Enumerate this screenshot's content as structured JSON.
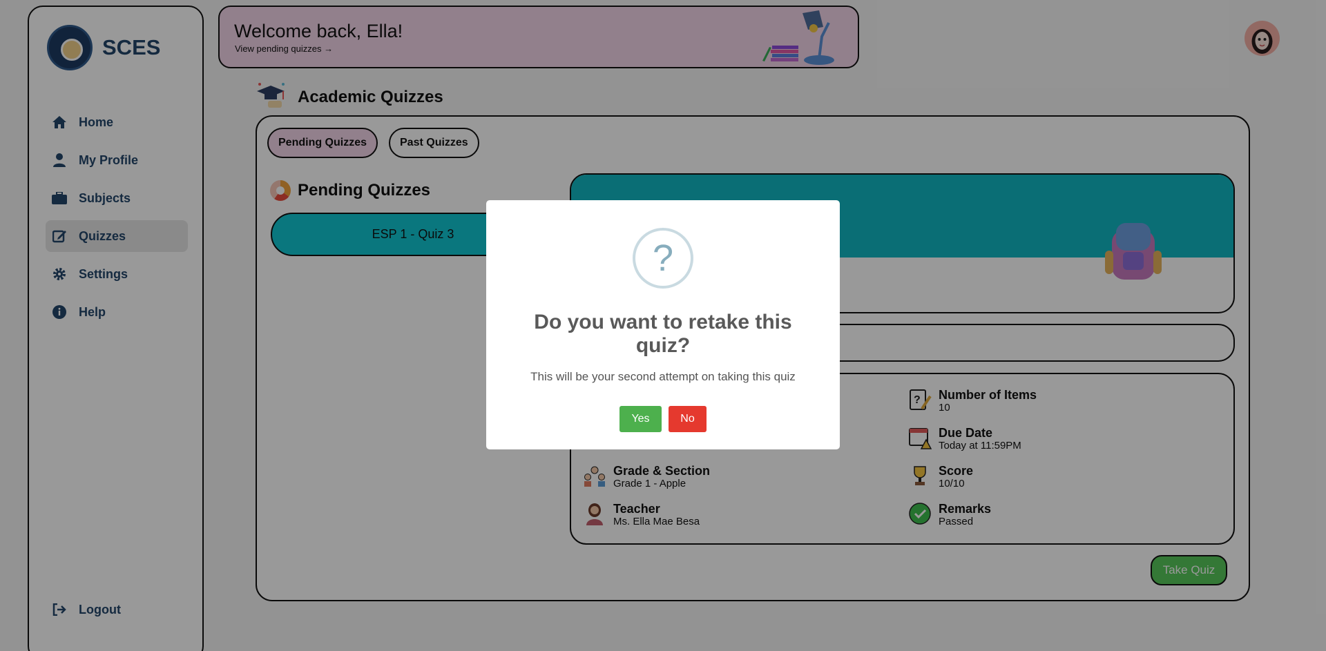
{
  "brand": {
    "name": "SCES"
  },
  "sidebar": {
    "items": [
      {
        "label": "Home",
        "icon": "home-icon"
      },
      {
        "label": "My Profile",
        "icon": "user-icon"
      },
      {
        "label": "Subjects",
        "icon": "briefcase-icon"
      },
      {
        "label": "Quizzes",
        "icon": "edit-icon",
        "active": true
      },
      {
        "label": "Settings",
        "icon": "gear-icon"
      },
      {
        "label": "Help",
        "icon": "info-icon"
      }
    ],
    "logout": "Logout"
  },
  "banner": {
    "welcome": "Welcome back, Ella!",
    "link": "View pending quizzes →"
  },
  "page": {
    "title": "Academic Quizzes"
  },
  "tabs": [
    {
      "label": "Pending Quizzes"
    },
    {
      "label": "Past Quizzes"
    }
  ],
  "list": {
    "title": "Pending Quizzes",
    "items": [
      {
        "label": "ESP 1 - Quiz 3"
      }
    ]
  },
  "details": {
    "mid_fragment": "-",
    "fields": [
      {
        "label": "Number of Items",
        "value": "10",
        "icon": "question-paper-icon"
      },
      {
        "label": "Due Date",
        "value": "Today at 11:59PM",
        "icon": "calendar-warning-icon"
      },
      {
        "label": "Grade & Section",
        "value": "Grade 1 - Apple",
        "icon": "students-icon"
      },
      {
        "label": "Score",
        "value": "10/10",
        "icon": "trophy-icon"
      },
      {
        "label": "Teacher",
        "value": "Ms. Ella Mae Besa",
        "icon": "teacher-icon"
      },
      {
        "label": "Remarks",
        "value": "Passed",
        "icon": "check-circle-icon"
      }
    ],
    "take_quiz": "Take Quiz"
  },
  "modal": {
    "icon": "?",
    "title": "Do you want to retake this quiz?",
    "text": "This will be your second attempt on taking this quiz",
    "yes": "Yes",
    "no": "No"
  },
  "colors": {
    "accent": "#12c7d3",
    "banner": "#f3d6ea",
    "brand_text": "#23466b",
    "yes": "#4db04d",
    "no": "#e5392e",
    "take_quiz": "#57c85b"
  }
}
